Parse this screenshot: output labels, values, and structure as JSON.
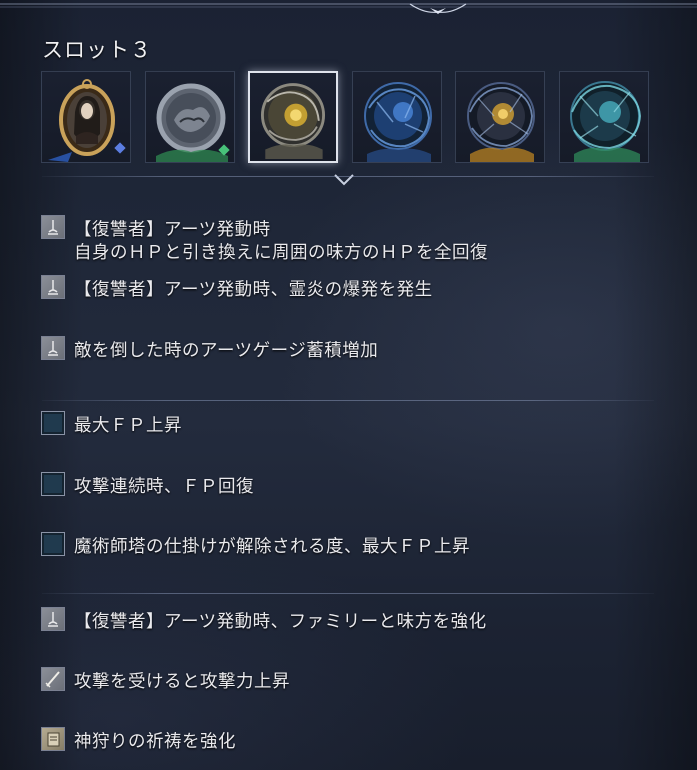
{
  "slot": {
    "title": "スロット３"
  },
  "slot_icons": [
    {
      "name": "pendant-portrait-icon",
      "selected": false
    },
    {
      "name": "gray-relic-orb-icon",
      "selected": false
    },
    {
      "name": "golden-relic-orb-icon",
      "selected": true
    },
    {
      "name": "blue-relic-orb-icon",
      "selected": false
    },
    {
      "name": "amber-relic-orb-icon",
      "selected": false
    },
    {
      "name": "teal-relic-orb-icon",
      "selected": false
    }
  ],
  "effects": [
    {
      "icon": "revenant-arts-icon",
      "lines": [
        "【復讐者】アーツ発動時",
        "自身のＨＰと引き換えに周囲の味方のＨＰを全回復"
      ]
    },
    {
      "icon": "revenant-arts-icon",
      "lines": [
        "【復讐者】アーツ発動時、霊炎の爆発を発生"
      ]
    },
    {
      "icon": "revenant-arts-icon",
      "lines": [
        "敵を倒した時のアーツゲージ蓄積増加"
      ]
    },
    {
      "icon": "fp-blue-icon",
      "lines": [
        "最大ＦＰ上昇"
      ]
    },
    {
      "icon": "fp-blue-icon",
      "lines": [
        "攻撃連続時、ＦＰ回復"
      ]
    },
    {
      "icon": "fp-blue-icon",
      "lines": [
        "魔術師塔の仕掛けが解除される度、最大ＦＰ上昇"
      ]
    },
    {
      "icon": "revenant-arts-icon",
      "lines": [
        "【復讐者】アーツ発動時、ファミリーと味方を強化"
      ]
    },
    {
      "icon": "sword-attack-icon",
      "lines": [
        "攻撃を受けると攻撃力上昇"
      ]
    },
    {
      "icon": "incantation-scroll-icon",
      "lines": [
        "神狩りの祈祷を強化"
      ]
    }
  ]
}
